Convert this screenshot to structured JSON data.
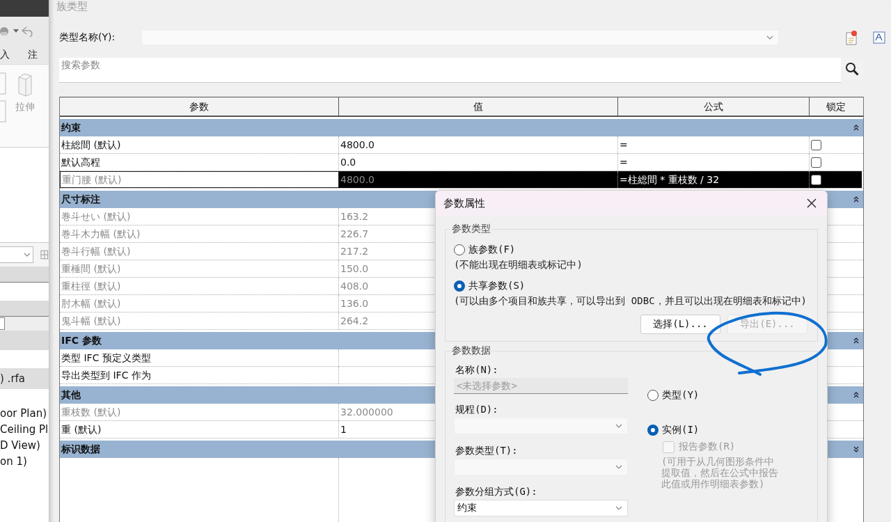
{
  "background_app": {
    "ribbon_tabs": [
      "入",
      "注"
    ],
    "ribbon_button": "拉伸",
    "file_label": ") .rfa",
    "browser_items": [
      "oor Plan)",
      "Ceiling Pl",
      "D View)",
      "on 1)"
    ]
  },
  "family_types": {
    "title": "族类型",
    "type_name_label": "类型名称(Y):",
    "search": {
      "placeholder": "搜索参数"
    },
    "table": {
      "columns": [
        "参数",
        "值",
        "公式",
        "锁定"
      ],
      "groups": [
        {
          "name": "约束",
          "expanded": true,
          "rows": [
            {
              "name": "柱総間 (默认)",
              "value": "4800.0",
              "formula": "=",
              "locked": false,
              "greyed": false,
              "selected": false
            },
            {
              "name": "默认高程",
              "value": "0.0",
              "formula": "=",
              "locked": false,
              "greyed": false,
              "selected": false
            },
            {
              "name": "重门腰 (默认)",
              "value": "4800.0",
              "formula": "=柱総間 * 重枝数 / 32",
              "locked": false,
              "greyed": true,
              "selected": true
            }
          ]
        },
        {
          "name": "尺寸标注",
          "expanded": true,
          "rows": [
            {
              "name": "巻斗せい (默认)",
              "value": "163.2",
              "greyed": true,
              "selected": false
            },
            {
              "name": "巻斗木力幅 (默认)",
              "value": "226.7",
              "greyed": true,
              "selected": false
            },
            {
              "name": "巻斗行幅 (默认)",
              "value": "217.2",
              "greyed": true,
              "selected": false
            },
            {
              "name": "重棰間 (默认)",
              "value": "150.0",
              "greyed": true,
              "selected": false
            },
            {
              "name": "重柱徑 (默认)",
              "value": "408.0",
              "greyed": true,
              "selected": false
            },
            {
              "name": "肘木幅 (默认)",
              "value": "136.0",
              "greyed": true,
              "selected": false
            },
            {
              "name": "鬼斗幅 (默认)",
              "value": "264.2",
              "greyed": true,
              "selected": false
            }
          ]
        },
        {
          "name": "IFC 参数",
          "expanded": true,
          "rows": [
            {
              "name": "类型 IFC 预定义类型",
              "greyed": false,
              "selected": false
            },
            {
              "name": "导出类型到 IFC 作为",
              "greyed": false,
              "selected": false
            }
          ]
        },
        {
          "name": "其他",
          "expanded": true,
          "rows": [
            {
              "name": "重枝数 (默认)",
              "value": "32.000000",
              "greyed": true,
              "selected": false
            },
            {
              "name": "重 (默认)",
              "value": "1",
              "greyed": false,
              "selected": false
            }
          ]
        },
        {
          "name": "标识数据",
          "expanded": false
        }
      ]
    }
  },
  "parameter_properties": {
    "title": "参数属性",
    "parameter_type": {
      "legend": "参数类型",
      "options": [
        {
          "label": "族参数(F)",
          "hint": "(不能出现在明细表或标记中)",
          "selected": false
        },
        {
          "label": "共享参数(S)",
          "hint": "(可以由多个项目和族共享，可以导出到 ODBC，并且可以出现在明细表和标记中)",
          "selected": true
        }
      ],
      "buttons": [
        {
          "label": "选择(L)...",
          "disabled": false
        },
        {
          "label": "导出(E)...",
          "disabled": true
        }
      ]
    },
    "parameter_data": {
      "legend": "参数数据",
      "fields": [
        {
          "kind": "text",
          "label": "名称(N):",
          "placeholder": "<未选择参数>",
          "disabled": true
        },
        {
          "kind": "select",
          "label": "规程(D):",
          "disabled": true
        },
        {
          "kind": "select",
          "label": "参数类型(T):",
          "disabled": true
        },
        {
          "kind": "select",
          "label": "参数分组方式(G):",
          "value": "约束",
          "disabled": false
        }
      ],
      "scope": [
        {
          "label": "类型(Y)",
          "selected": false
        },
        {
          "label": "实例(I)",
          "selected": true
        }
      ],
      "report": {
        "label": "报告参数(R)",
        "checked": false,
        "disabled": true,
        "hint": "(可用于从几何图形条件中提取值，然后在公式中报告此值或用作明细表参数)"
      }
    }
  }
}
